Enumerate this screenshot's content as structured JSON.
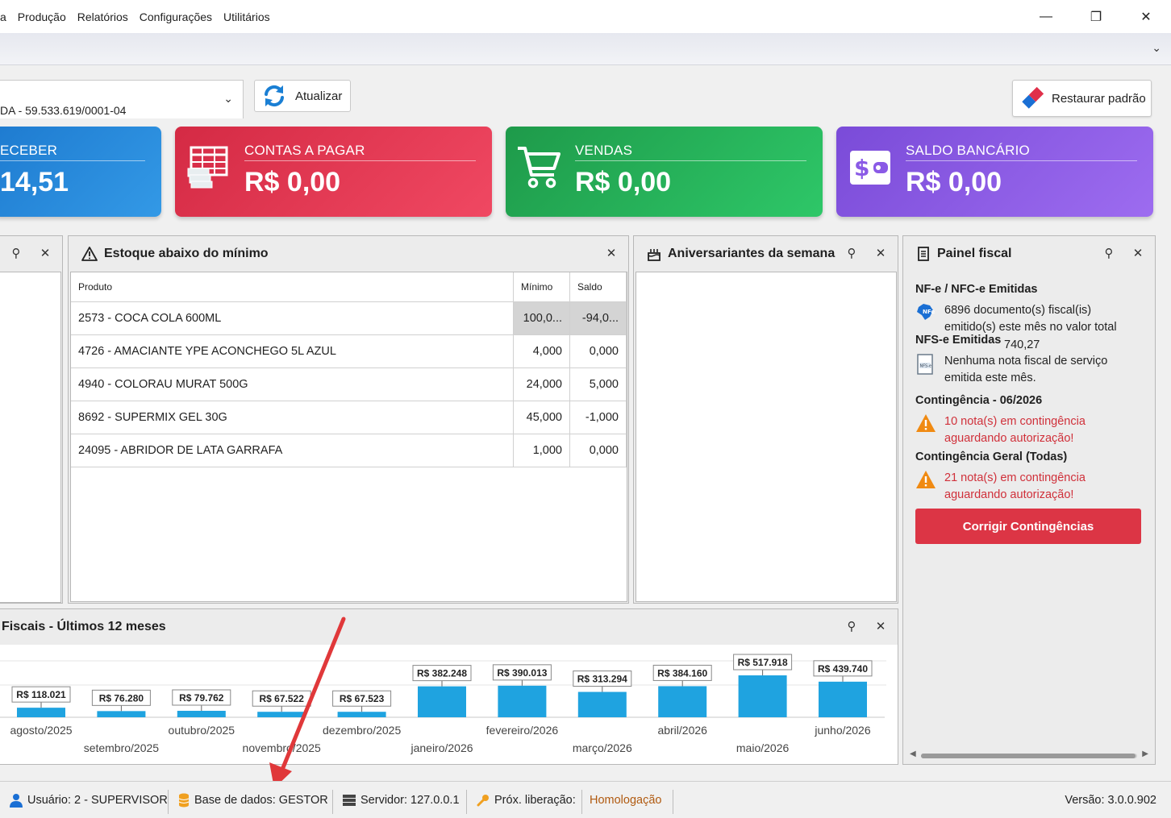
{
  "menu": [
    "a",
    "Produção",
    "Relatórios",
    "Configurações",
    "Utilitários"
  ],
  "window_controls": {
    "minimize": "—",
    "maximize": "❐",
    "close": "✕"
  },
  "toolbar": {
    "company": "DA - 59.533.619/0001-04",
    "refresh_label": "Atualizar",
    "restore_label": "Restaurar padrão"
  },
  "cards": {
    "receber": {
      "title": "ECEBER",
      "value": "14,51",
      "color": "#1e7bd0"
    },
    "pagar": {
      "title": "CONTAS A PAGAR",
      "value": "R$ 0,00",
      "color": "#d42a44"
    },
    "vendas": {
      "title": "VENDAS",
      "value": "R$ 0,00",
      "color": "#1e9a4a"
    },
    "saldo": {
      "title": "SALDO BANCÁRIO",
      "value": "R$ 0,00",
      "color": "#7a4bd8"
    }
  },
  "estoque": {
    "title": "Estoque abaixo do mínimo",
    "columns": [
      "Produto",
      "Mínimo",
      "Saldo"
    ],
    "rows": [
      {
        "produto": "2573 - COCA COLA 600ML",
        "minimo": "100,0...",
        "saldo": "-94,0..."
      },
      {
        "produto": "4726 - AMACIANTE YPE ACONCHEGO 5L AZUL",
        "minimo": "4,000",
        "saldo": "0,000"
      },
      {
        "produto": "4940 - COLORAU MURAT 500G",
        "minimo": "24,000",
        "saldo": "5,000"
      },
      {
        "produto": "8692 - SUPERMIX GEL 30G",
        "minimo": "45,000",
        "saldo": "-1,000"
      },
      {
        "produto": "24095 - ABRIDOR DE LATA GARRAFA",
        "minimo": "1,000",
        "saldo": "0,000"
      }
    ]
  },
  "aniversariantes": {
    "title": "Aniversariantes da semana"
  },
  "painel_fiscal": {
    "title": "Painel fiscal",
    "nfe_title": "NF-e / NFC-e Emitidas",
    "nfe_line1": "6896 documento(s) fiscal(is)",
    "nfe_line2": "emitido(s) este mês no valor total",
    "nfse_title": "NFS-e Emitidas",
    "nfe_value_tail": "740,27",
    "nfse_line1": "Nenhuma nota fiscal de serviço",
    "nfse_line2": "emitida este mês.",
    "cont_title": "Contingência - 06/2026",
    "cont_line1": "10 nota(s) em contingência",
    "cont_line2": "aguardando autorização!",
    "contg_title": "Contingência Geral (Todas)",
    "contg_line1": "21 nota(s) em contingência",
    "contg_line2": "aguardando autorização!",
    "fix_button": "Corrigir Contingências",
    "nfse_badge": "NFS-e"
  },
  "chart_title": "Fiscais - Últimos 12 meses",
  "chart_data": {
    "type": "bar",
    "title": "Fiscais - Últimos 12 meses",
    "categories": [
      "agosto/2025",
      "setembro/2025",
      "outubro/2025",
      "novembro/2025",
      "dezembro/2025",
      "janeiro/2026",
      "fevereiro/2026",
      "março/2026",
      "abril/2026",
      "maio/2026",
      "junho/2026"
    ],
    "values": [
      118021,
      76280,
      79762,
      67522,
      67523,
      382248,
      390013,
      313294,
      384160,
      517918,
      439740
    ],
    "labels": [
      "R$ 118.021",
      "R$ 76.280",
      "R$ 79.762",
      "R$ 67.522",
      "R$ 67.523",
      "R$ 382.248",
      "R$ 390.013",
      "R$ 313.294",
      "R$ 384.160",
      "R$ 517.918",
      "R$ 439.740"
    ],
    "bar_color": "#1fa3e0"
  },
  "status": {
    "usuario": "Usuário: 2 - SUPERVISOR",
    "base": "Base de dados: GESTOR",
    "servidor": "Servidor: 127.0.0.1",
    "liberacao": "Próx. liberação:",
    "ambiente": "Homologação",
    "versao": "Versão: 3.0.0.902"
  }
}
